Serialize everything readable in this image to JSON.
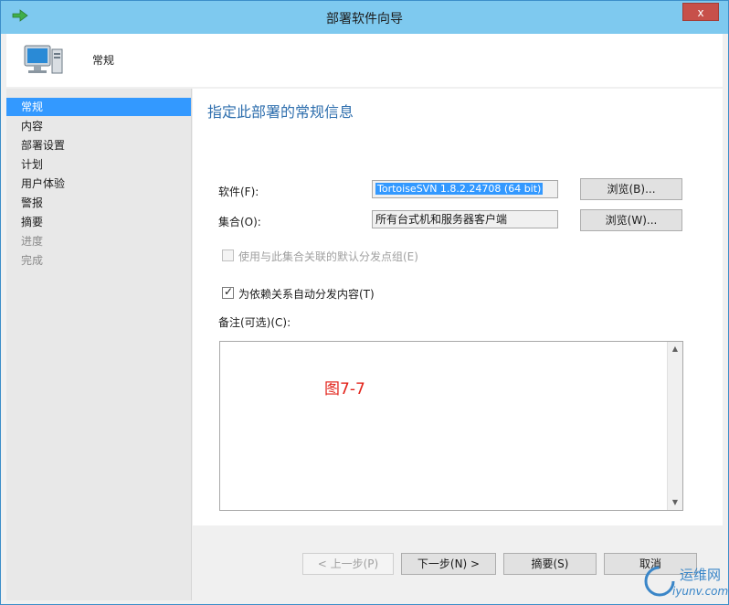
{
  "window": {
    "title": "部署软件向导",
    "close_label": "x"
  },
  "header": {
    "page_label": "常规"
  },
  "nav": {
    "items": [
      {
        "label": "常规"
      },
      {
        "label": "内容"
      },
      {
        "label": "部署设置"
      },
      {
        "label": "计划"
      },
      {
        "label": "用户体验"
      },
      {
        "label": "警报"
      },
      {
        "label": "摘要"
      },
      {
        "label": "进度"
      },
      {
        "label": "完成"
      }
    ]
  },
  "main": {
    "heading": "指定此部署的常规信息",
    "software_label": "软件(F):",
    "software_value": "TortoiseSVN 1.8.2.24708 (64 bit)",
    "browse_software_label": "浏览(B)...",
    "collection_label": "集合(O):",
    "collection_value": "所有台式机和服务器客户端",
    "browse_collection_label": "浏览(W)...",
    "default_dp_group_label": "使用与此集合关联的默认分发点组(E)",
    "auto_distribute_label": "为依赖关系自动分发内容(T)",
    "comments_label": "备注(可选)(C):",
    "figure_caption": "图7-7"
  },
  "footer": {
    "prev_label": "< 上一步(P)",
    "next_label": "下一步(N) >",
    "summary_label": "摘要(S)",
    "cancel_label": "取消"
  },
  "watermark": {
    "text": "运维网",
    "url": "iyunv.com"
  },
  "colors": {
    "titlebar": "#7ec9ef",
    "selection": "#3399ff",
    "heading": "#2f6fae",
    "caption_red": "#e2231a"
  }
}
